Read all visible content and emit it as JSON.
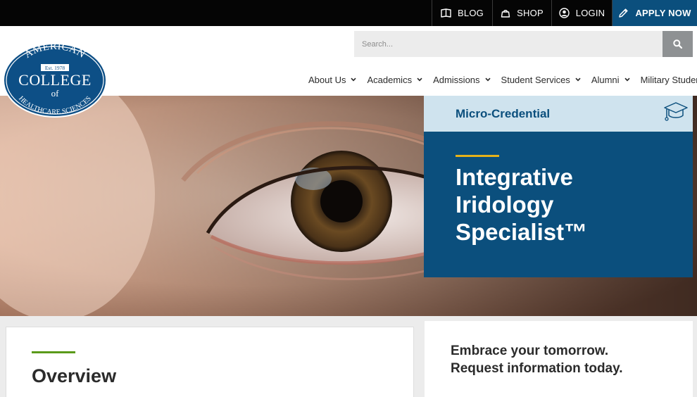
{
  "topbar": {
    "blog": "BLOG",
    "shop": "SHOP",
    "login": "LOGIN",
    "apply": "APPLY NOW"
  },
  "logo": {
    "top_text": "AMERICAN",
    "est": "Est. 1978",
    "middle_text": "COLLEGE",
    "of_text": "of",
    "bottom_text": "HEALTHCARE SCIENCES"
  },
  "search": {
    "placeholder": "Search..."
  },
  "nav": {
    "items": [
      {
        "label": "About Us"
      },
      {
        "label": "Academics"
      },
      {
        "label": "Admissions"
      },
      {
        "label": "Student Services"
      },
      {
        "label": "Alumni"
      },
      {
        "label": "Military Students"
      }
    ]
  },
  "hero": {
    "badge": "Micro-Credential",
    "title_line1": "Integrative",
    "title_line2": "Iridology",
    "title_line3": "Specialist™"
  },
  "overview": {
    "title": "Overview"
  },
  "rfi": {
    "line1": "Embrace your tomorrow.",
    "line2": "Request information today."
  },
  "colors": {
    "brand_blue": "#0b4f7d",
    "light_blue": "#cfe3ee",
    "gold_accent": "#e6b21a",
    "green_accent": "#5a9a1a",
    "topbar_bg": "#050505"
  }
}
